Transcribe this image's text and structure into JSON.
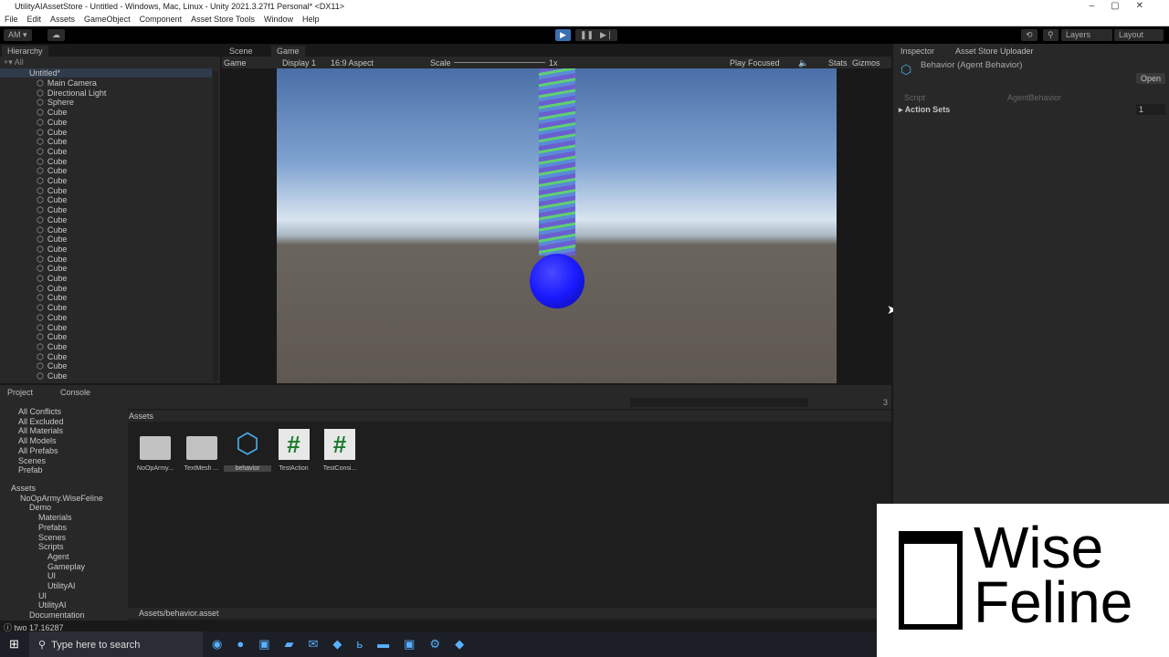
{
  "window": {
    "title": "UtilityAIAssetStore - Untitled - Windows, Mac, Linux - Unity 2021.3.27f1 Personal* <DX11>"
  },
  "menu": [
    "File",
    "Edit",
    "Assets",
    "GameObject",
    "Component",
    "Asset Store Tools",
    "Window",
    "Help"
  ],
  "toolbar": {
    "account": "AM ▾",
    "layers": "Layers",
    "layout": "Layout"
  },
  "hierarchy": {
    "tab": "Hierarchy",
    "search_placeholder": "All",
    "scene": "Untitled*",
    "items": [
      "Main Camera",
      "Directional Light",
      "Sphere",
      "Cube",
      "Cube",
      "Cube",
      "Cube",
      "Cube",
      "Cube",
      "Cube",
      "Cube",
      "Cube",
      "Cube",
      "Cube",
      "Cube",
      "Cube",
      "Cube",
      "Cube",
      "Cube",
      "Cube",
      "Cube",
      "Cube",
      "Cube",
      "Cube",
      "Cube",
      "Cube",
      "Cube",
      "Cube",
      "Cube",
      "Cube",
      "Cube"
    ]
  },
  "game": {
    "tabs": [
      "Scene",
      "Game"
    ],
    "mode": "Game",
    "display": "Display 1",
    "aspect": "16:9 Aspect",
    "scale_label": "Scale",
    "scale_value": "1x",
    "play_focused": "Play Focused",
    "stats": "Stats",
    "gizmos": "Gizmos",
    "sphere_color": "#1a1aff"
  },
  "inspector": {
    "tabs": [
      "Inspector",
      "Asset Store Uploader"
    ],
    "title": "Behavior (Agent Behavior)",
    "open": "Open",
    "script_label": "Script",
    "script_value": "AgentBehavior",
    "action_sets": "Action Sets",
    "action_sets_count": "1"
  },
  "project": {
    "tabs": [
      "Project",
      "Console"
    ],
    "favorites": [
      "All Conflicts",
      "All Excluded",
      "All Materials",
      "All Models",
      "All Prefabs",
      "Scenes",
      "Prefab"
    ],
    "tree": [
      {
        "label": "Assets",
        "d": 0
      },
      {
        "label": "NoOpArmy.WiseFeline",
        "d": 1
      },
      {
        "label": "Demo",
        "d": 2
      },
      {
        "label": "Materials",
        "d": 3
      },
      {
        "label": "Prefabs",
        "d": 3
      },
      {
        "label": "Scenes",
        "d": 3
      },
      {
        "label": "Scripts",
        "d": 3
      },
      {
        "label": "Agent",
        "d": 4
      },
      {
        "label": "Gameplay",
        "d": 4
      },
      {
        "label": "UI",
        "d": 4
      },
      {
        "label": "UtilityAI",
        "d": 4
      },
      {
        "label": "UI",
        "d": 3
      },
      {
        "label": "UtilityAI",
        "d": 3
      },
      {
        "label": "Documentation",
        "d": 2
      }
    ],
    "breadcrumb": "Assets",
    "assets": [
      "NoOpArmy...",
      "TextMesh ...",
      "behavior",
      "TestAction",
      "TestConsi..."
    ],
    "path": "Assets/behavior.asset",
    "badge": "3"
  },
  "status": "two 17.16287",
  "taskbar": {
    "search_placeholder": "Type here to search"
  },
  "logo": {
    "line1": "Wise",
    "line2": "Feline"
  }
}
